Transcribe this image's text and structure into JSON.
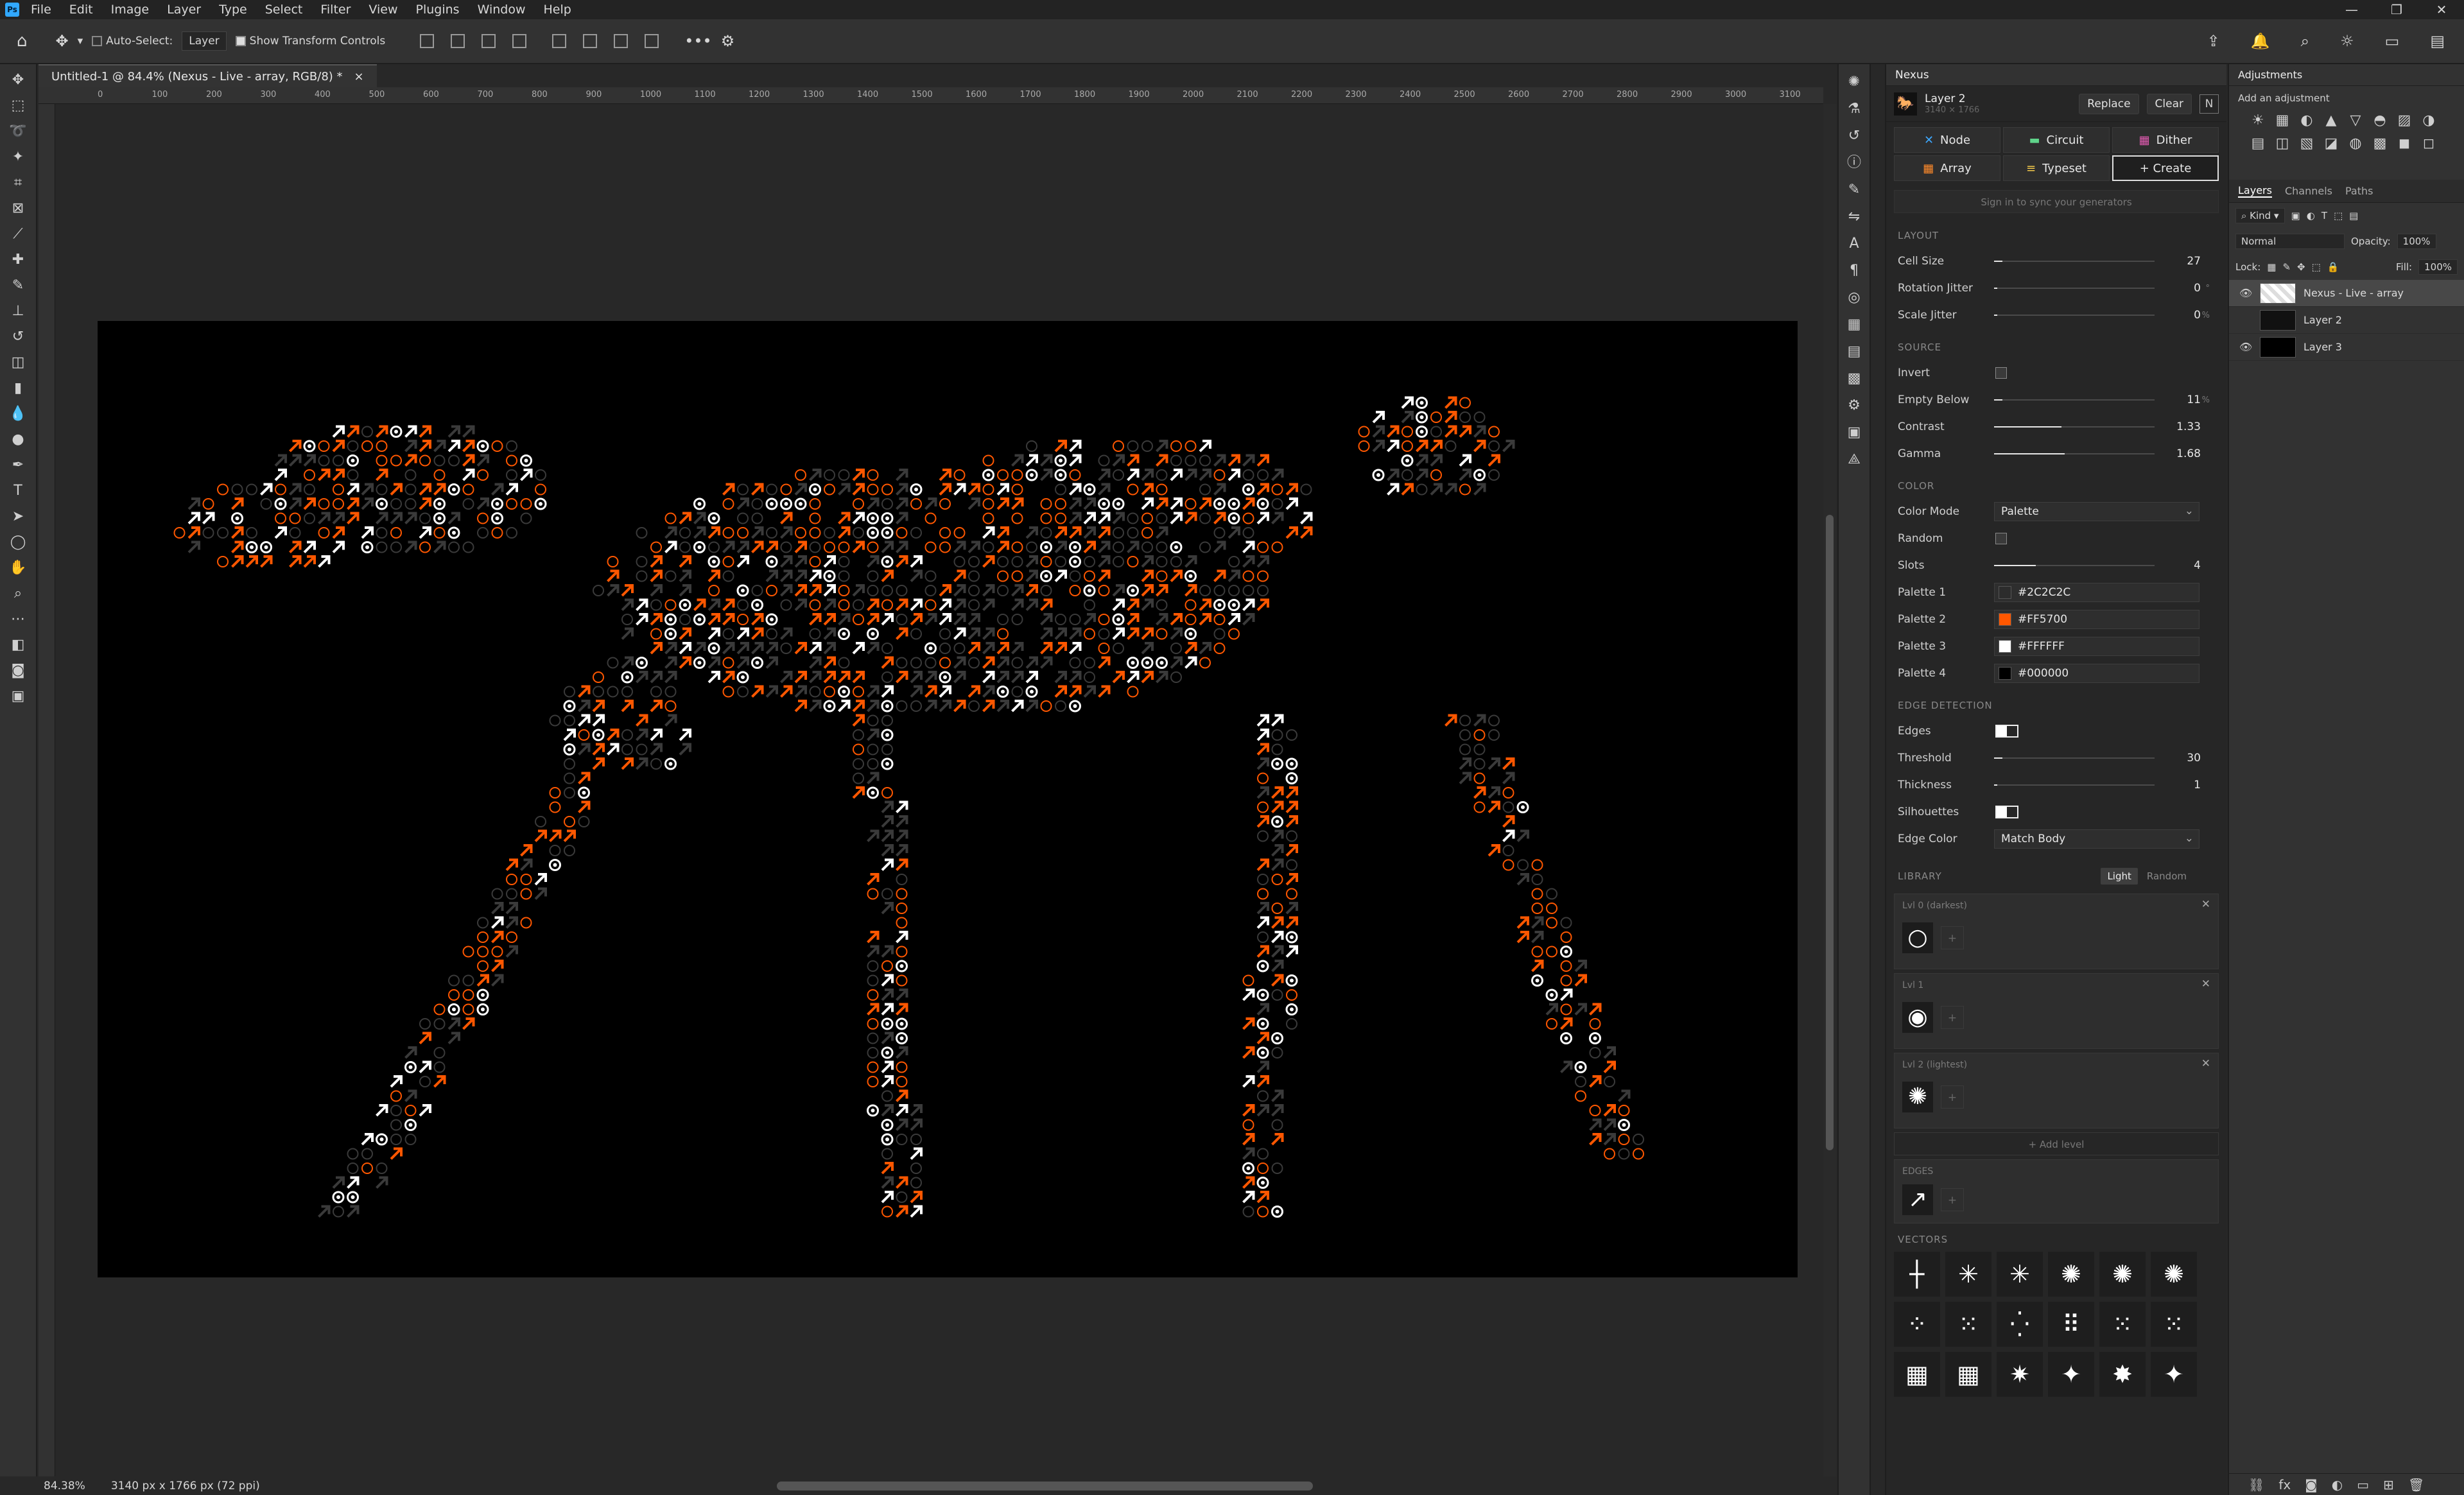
{
  "app": {
    "badge": "Ps",
    "window_controls": [
      "—",
      "❐",
      "✕"
    ]
  },
  "menu": [
    "File",
    "Edit",
    "Image",
    "Layer",
    "Type",
    "Select",
    "Filter",
    "View",
    "Plugins",
    "Window",
    "Help"
  ],
  "options": {
    "auto_select_label": "Auto-Select:",
    "auto_select_value": "Layer",
    "transform_label": "Show Transform Controls"
  },
  "document": {
    "tab_title": "Untitled-1 @ 84.4% (Nexus - Live - array, RGB/8) *",
    "close": "×",
    "zoom": "84.38%",
    "info": "3140 px x 1766 px (72 ppi)"
  },
  "ruler_labels": [
    "0",
    "100",
    "200",
    "300",
    "400",
    "500",
    "600",
    "700",
    "800",
    "900",
    "1000",
    "1100",
    "1200",
    "1300",
    "1400",
    "1500",
    "1600",
    "1700",
    "1800",
    "1900",
    "2000",
    "2100",
    "2200",
    "2300",
    "2400",
    "2500",
    "2600",
    "2700",
    "2800",
    "2900",
    "3000",
    "3100"
  ],
  "nexus": {
    "panel_title": "Nexus",
    "layer_name": "Layer 2",
    "layer_dims": "3140 × 1766",
    "replace": "Replace",
    "clear": "Clear",
    "modes": [
      {
        "label": "Node",
        "icon": "✕",
        "color": "#3da8ff"
      },
      {
        "label": "Circuit",
        "icon": "▬",
        "color": "#5fd38a"
      },
      {
        "label": "Dither",
        "icon": "▦",
        "color": "#e05ab0"
      },
      {
        "label": "Array",
        "icon": "▦",
        "color": "#ff8a2a"
      },
      {
        "label": "Typeset",
        "icon": "≡",
        "color": "#f2c84b"
      },
      {
        "label": "+ Create",
        "icon": "",
        "color": "#ffffff"
      }
    ],
    "sync": "Sign in to sync your generators",
    "layout": {
      "title": "LAYOUT",
      "cell_size": {
        "label": "Cell Size",
        "value": "27",
        "unit": "",
        "level": 0.05
      },
      "rotation_jitter": {
        "label": "Rotation Jitter",
        "value": "0",
        "unit": "°",
        "level": 0
      },
      "scale_jitter": {
        "label": "Scale Jitter",
        "value": "0",
        "unit": "%",
        "level": 0
      }
    },
    "source": {
      "title": "SOURCE",
      "invert": {
        "label": "Invert"
      },
      "empty_below": {
        "label": "Empty Below",
        "value": "11",
        "unit": "%",
        "level": 0.05
      },
      "contrast": {
        "label": "Contrast",
        "value": "1.33",
        "level": 0.42
      },
      "gamma": {
        "label": "Gamma",
        "value": "1.68",
        "level": 0.44
      }
    },
    "color": {
      "title": "COLOR",
      "mode_label": "Color Mode",
      "mode_value": "Palette",
      "random_label": "Random",
      "slots": {
        "label": "Slots",
        "value": "4",
        "level": 0.26
      },
      "palette": [
        {
          "label": "Palette 1",
          "hex": "#2C2C2C"
        },
        {
          "label": "Palette 2",
          "hex": "#FF5700"
        },
        {
          "label": "Palette 3",
          "hex": "#FFFFFF"
        },
        {
          "label": "Palette 4",
          "hex": "#000000"
        }
      ]
    },
    "edge": {
      "title": "EDGE DETECTION",
      "edges_label": "Edges",
      "threshold": {
        "label": "Threshold",
        "value": "30",
        "level": 0.05
      },
      "thickness": {
        "label": "Thickness",
        "value": "1",
        "level": 0.02
      },
      "silhouettes_label": "Silhouettes",
      "edge_color_label": "Edge Color",
      "edge_color_value": "Match Body"
    },
    "library": {
      "title": "LIBRARY",
      "tab_light": "Light",
      "tab_random": "Random",
      "levels": [
        {
          "name": "Lvl 0 (darkest)",
          "glyph": "○"
        },
        {
          "name": "Lvl 1",
          "glyph": "◉"
        },
        {
          "name": "Lvl 2 (lightest)",
          "glyph": "✺"
        }
      ],
      "add_level": "+ Add level",
      "edges_title": "EDGES",
      "edges_glyph": "↗",
      "vectors_title": "VECTORS",
      "vectors": [
        "┼",
        "✳",
        "✳",
        "✺",
        "✺",
        "✺",
        "⁘",
        "⁙",
        "⁛",
        "⠿",
        "⁙",
        "⁙",
        "▦",
        "▦",
        "✷",
        "✦",
        "✸",
        "✦"
      ]
    }
  },
  "adjustments": {
    "title": "Adjustments",
    "subtitle": "Add an adjustment",
    "icons": [
      "☀",
      "▦",
      "◐",
      "▲",
      "▽",
      "◓",
      "▨",
      "◑",
      "▤",
      "◫",
      "▧",
      "◪",
      "◍",
      "▩",
      "◼",
      "◻"
    ]
  },
  "layers_panel": {
    "tabs": [
      "Layers",
      "Channels",
      "Paths"
    ],
    "kind": "Kind",
    "blend": "Normal",
    "opacity_label": "Opacity:",
    "opacity": "100%",
    "lock_label": "Lock:",
    "fill_label": "Fill:",
    "fill": "100%",
    "layers": [
      {
        "name": "Nexus - Live - array",
        "visible": "👁",
        "selected": true
      },
      {
        "name": "Layer 2",
        "visible": "",
        "selected": false
      },
      {
        "name": "Layer 3",
        "visible": "👁",
        "selected": false
      }
    ]
  },
  "colors": {
    "orange": "#FF5700",
    "gray": "#2C2C2C",
    "white": "#FFFFFF"
  }
}
